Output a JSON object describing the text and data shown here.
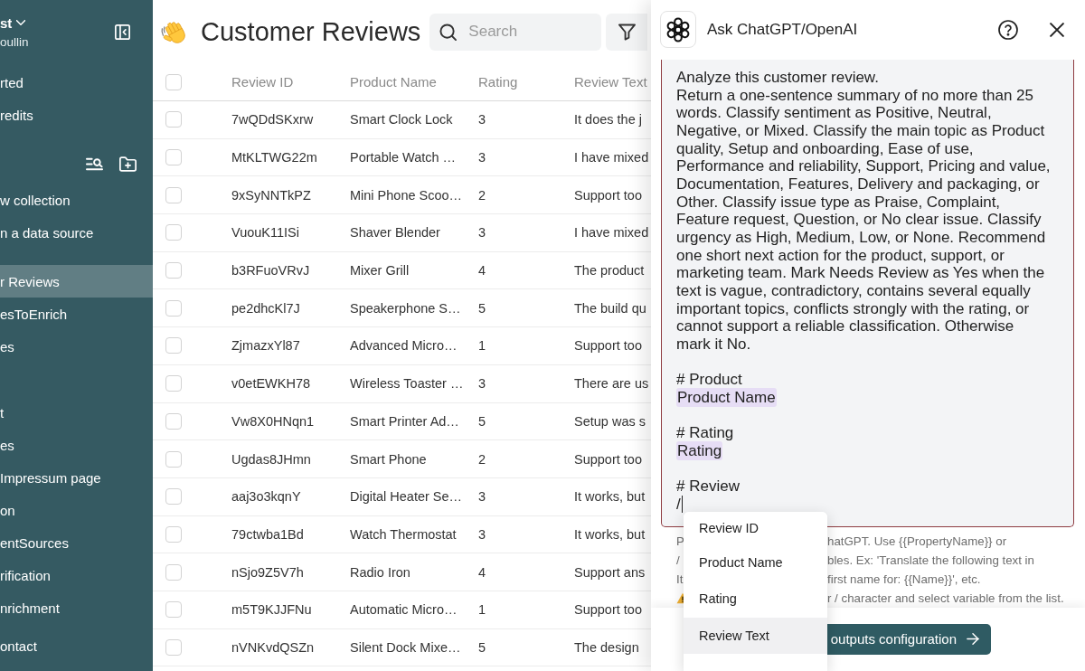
{
  "sidebar": {
    "account": {
      "name": "st",
      "subtitle": "oullin"
    },
    "groups": [
      {
        "items": [
          {
            "label": "rted",
            "selected": false
          },
          {
            "label": "redits",
            "selected": false
          }
        ]
      },
      {
        "items": [
          {
            "label": "w collection",
            "selected": false
          },
          {
            "label": "n a data source",
            "selected": false
          }
        ]
      },
      {
        "items": [
          {
            "label": "r Reviews",
            "selected": true
          },
          {
            "label": "esToEnrich",
            "selected": false
          },
          {
            "label": "es",
            "selected": false
          }
        ]
      },
      {
        "items": [
          {
            "label": "t",
            "selected": false
          },
          {
            "label": "es",
            "selected": false
          },
          {
            "label": "Impressum page",
            "selected": false
          },
          {
            "label": "on",
            "selected": false
          },
          {
            "label": "entSources",
            "selected": false
          },
          {
            "label": "rification",
            "selected": false
          },
          {
            "label": "nrichment",
            "selected": false
          }
        ]
      },
      {
        "items": [
          {
            "label": "ontact",
            "selected": false
          }
        ]
      }
    ]
  },
  "page": {
    "title": "Customer Reviews",
    "search": {
      "placeholder": "Search"
    }
  },
  "table": {
    "select_all": {
      "checked": false
    },
    "columns": [
      "Review ID",
      "Product Name",
      "Rating",
      "Review Text"
    ],
    "rows": [
      {
        "checked": false,
        "cells": [
          "7wQDdSKxrw",
          "Smart Clock Lock",
          "3",
          "It does the j"
        ]
      },
      {
        "checked": false,
        "cells": [
          "MtKLTWG22m",
          "Portable Watch …",
          "3",
          "I have mixed"
        ]
      },
      {
        "checked": false,
        "cells": [
          "9xSyNNTkPZ",
          "Mini Phone Scoo…",
          "2",
          "Support too"
        ]
      },
      {
        "checked": false,
        "cells": [
          "VuouK11ISi",
          "Shaver Blender",
          "3",
          "I have mixed"
        ]
      },
      {
        "checked": false,
        "cells": [
          "b3RFuoVRvJ",
          "Mixer Grill",
          "4",
          "The product"
        ]
      },
      {
        "checked": false,
        "cells": [
          "pe2dhcKl7J",
          "Speakerphone S…",
          "5",
          "The build qu"
        ]
      },
      {
        "checked": false,
        "cells": [
          "ZjmazxYl87",
          "Advanced Micro…",
          "1",
          "Support too"
        ]
      },
      {
        "checked": false,
        "cells": [
          "v0etEWKH78",
          "Wireless Toaster …",
          "3",
          "There are us"
        ]
      },
      {
        "checked": false,
        "cells": [
          "Vw8X0HNqn1",
          "Smart Printer Ad…",
          "5",
          "Setup was s"
        ]
      },
      {
        "checked": false,
        "cells": [
          "Ugdas8JHmn",
          "Smart Phone",
          "2",
          "Support too"
        ]
      },
      {
        "checked": false,
        "cells": [
          "aaj3o3kqnY",
          "Digital Heater Se…",
          "3",
          "It works, but"
        ]
      },
      {
        "checked": false,
        "cells": [
          "79ctwba1Bd",
          "Watch Thermostat",
          "3",
          "It works, but"
        ]
      },
      {
        "checked": false,
        "cells": [
          "nSjo9Z5V7h",
          "Radio Iron",
          "4",
          "Support ans"
        ]
      },
      {
        "checked": false,
        "cells": [
          "m5T9KJJFNu",
          "Automatic Micro…",
          "1",
          "Support too"
        ]
      },
      {
        "checked": false,
        "cells": [
          "nVNKvdQSZn",
          "Silent Dock Mixe…",
          "5",
          "The design"
        ]
      }
    ]
  },
  "panel": {
    "title": "Ask ChatGPT/OpenAI",
    "prompt": {
      "intro": "Analyze this customer review.\nReturn a one-sentence summary of no more than 25 words. Classify sentiment as Positive, Neutral, Negative, or Mixed. Classify the main topic as Product quality, Setup and onboarding, Ease of use, Performance and reliability, Support, Pricing and value, Documentation, Features, Delivery and packaging, or Other. Classify issue type as Praise, Complaint, Feature request, Question, or No clear issue. Classify urgency as High, Medium, Low, or None. Recommend one short next action for the product, support, or marketing team. Mark Needs Review as Yes when the text is vague, contradictory, contains several equally important topics, conflicts strongly with the rating, or cannot support a reliable classification. Otherwise mark it No.",
      "sections": [
        {
          "heading": "# Product",
          "kind": "variable",
          "value": "Product Name"
        },
        {
          "heading": "# Rating",
          "kind": "variable",
          "value": "Rating"
        },
        {
          "heading": "# Review",
          "kind": "typed",
          "value": "/"
        }
      ]
    },
    "helper_lines": [
      {
        "kind": "text",
        "before_menu": "P",
        "after_menu": "hatGPT. Use {{PropertyName}} or"
      },
      {
        "kind": "text",
        "before_menu": "/",
        "after_menu": "bles. Ex: 'Translate the following text in"
      },
      {
        "kind": "text",
        "before_menu": "It",
        "after_menu": "first name for: {{Name}}', etc."
      },
      {
        "kind": "warning",
        "after_menu": "r / character and select variable from the list."
      }
    ],
    "variable_menu": {
      "items": [
        {
          "label": "Review ID",
          "selected": false
        },
        {
          "label": "Product Name",
          "selected": false
        },
        {
          "label": "Rating",
          "selected": false
        },
        {
          "label": "Review Text",
          "selected": true
        }
      ]
    },
    "primary_button": {
      "label": "outputs configuration"
    }
  }
}
